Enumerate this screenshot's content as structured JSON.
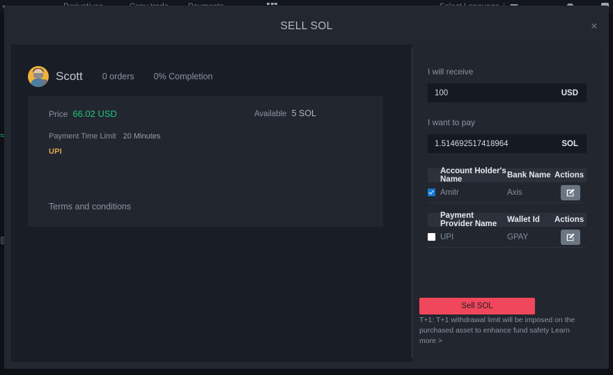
{
  "topnav": {
    "items": [
      {
        "label": "Derivatives",
        "has_caret": true
      },
      {
        "label": "Copy trade",
        "has_caret": false
      },
      {
        "label": "Payments",
        "has_caret": false
      }
    ],
    "apps_icon": "grid-apps-icon",
    "language_label": "Select Language",
    "dropdown_icon": "triangle-down-icon",
    "notification_icon": "bell-icon",
    "account_icon": "user-avatar-icon"
  },
  "modal": {
    "title": "SELL SOL",
    "close_icon": "close-icon"
  },
  "seller": {
    "avatar_icon": "user-avatar-icon",
    "name": "Scott",
    "orders": "0 orders",
    "completion": "0% Completion"
  },
  "offer": {
    "price_label": "Price",
    "price_value": "66.02 USD",
    "available_label": "Available",
    "available_value": "5 SOL",
    "time_limit_label": "Payment Time Limit",
    "time_limit_value": "20 Minutes",
    "payment_method": "UPI",
    "terms_label": "Terms and conditions"
  },
  "form": {
    "receive_label": "I will receive",
    "receive_value": "100",
    "receive_unit": "USD",
    "pay_label": "I want to pay",
    "pay_value": "1.514692517418964",
    "pay_unit": "SOL"
  },
  "bank_table": {
    "headers": {
      "name": "Account Holder's Name",
      "bank": "Bank Name",
      "actions": "Actions"
    },
    "rows": [
      {
        "selected": true,
        "name": "Amitr",
        "bank": "Axis",
        "action_icon": "edit-pencil-icon"
      }
    ]
  },
  "provider_table": {
    "headers": {
      "name": "Payment Provider Name",
      "wallet": "Wallet Id",
      "actions": "Actions"
    },
    "rows": [
      {
        "selected": false,
        "name": "UPI",
        "wallet": "GPAY",
        "action_icon": "edit-pencil-icon"
      }
    ]
  },
  "actions": {
    "sell_label": "Sell SOL",
    "tplus_note": "T+1: T+1 withdrawal limit will be imposed on the purchased asset to enhance fund safety Learn more >"
  },
  "colors": {
    "accent_sell": "#f0475c",
    "price_green": "#21c67a",
    "upi_gold": "#d7a84e",
    "checkbox_blue": "#1576d4"
  }
}
